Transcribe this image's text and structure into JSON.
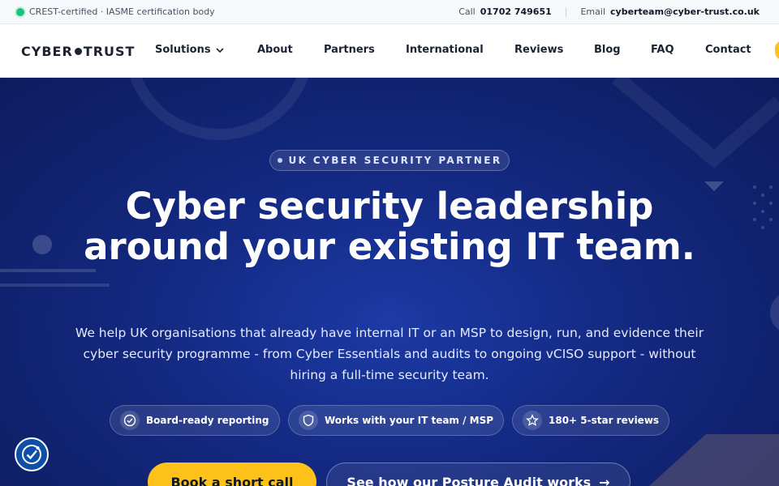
{
  "topbar": {
    "certification": "CREST-certified · IASME certification body",
    "call_label": "Call",
    "phone": "01702 749651",
    "email_label": "Email",
    "email": "cyberteam@cyber-trust.co.uk"
  },
  "nav": {
    "logo_left": "CYBER",
    "logo_right": "TRUST",
    "items": [
      "Solutions",
      "About",
      "Partners",
      "International",
      "Reviews",
      "Blog",
      "FAQ",
      "Contact"
    ]
  },
  "hero": {
    "badge": "UK CYBER SECURITY PARTNER",
    "headline": "Cyber security leadership around your existing IT team.",
    "subheading": "We help UK organisations that already have internal IT or an MSP to design, run, and evidence their cyber security programme - from Cyber Essentials and audits to ongoing vCISO support - without hiring a full-time security team.",
    "pills": [
      "Board-ready reporting",
      "Works with your IT team / MSP",
      "180+ 5-star reviews"
    ],
    "cta_primary": "Book a short call",
    "cta_secondary": "See how our Posture Audit works",
    "arrow": "→"
  },
  "colors": {
    "accent": "#ffc21a",
    "hero_bg": "#13287f",
    "status_green": "#1cc27a"
  },
  "icons": [
    "check-circle-icon",
    "shield-icon",
    "star-icon",
    "chevron-down-icon",
    "accessibility-icon"
  ]
}
